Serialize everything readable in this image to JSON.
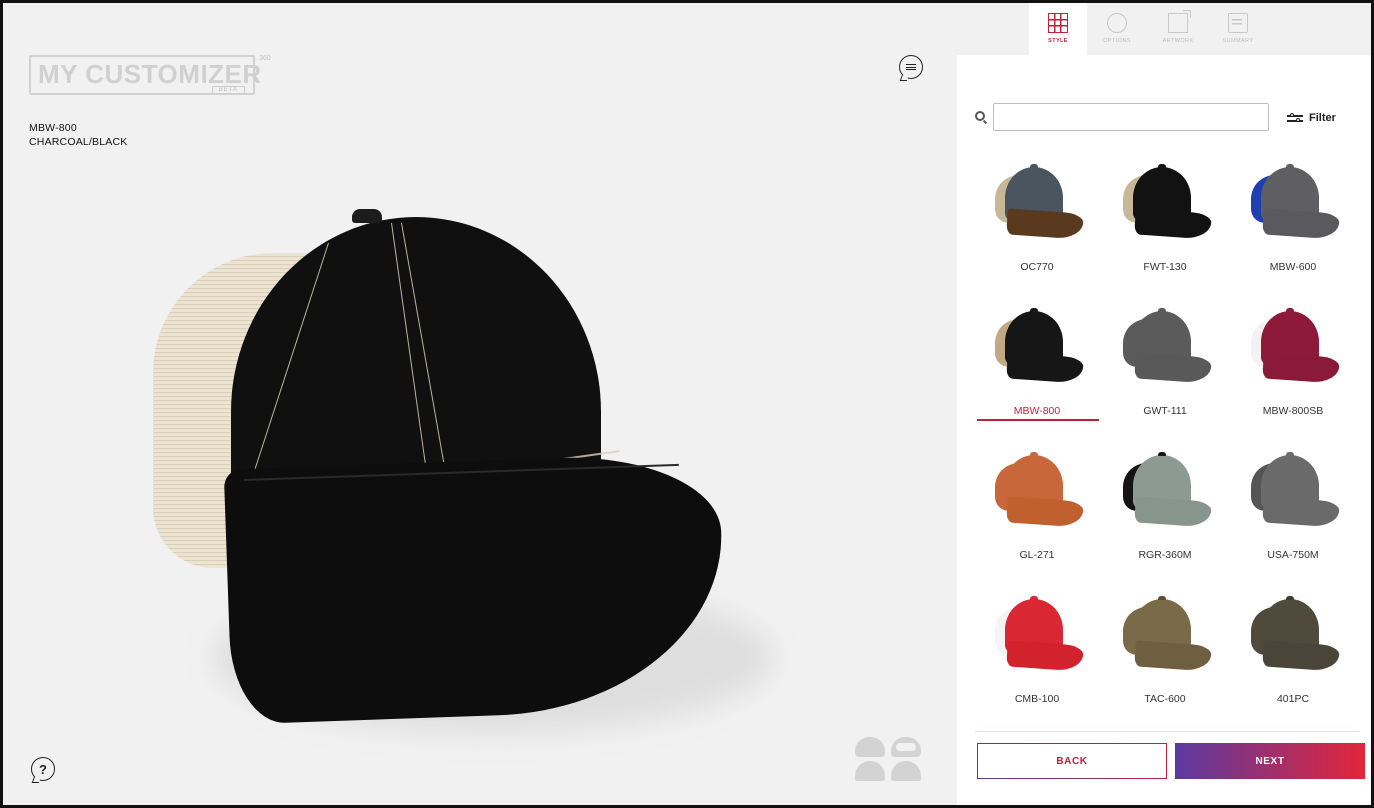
{
  "brand": {
    "name": "MY CUSTOMIZER",
    "superscript": "360",
    "tag": "BETA"
  },
  "product": {
    "code": "MBW-800",
    "color": "CHARCOAL/BLACK"
  },
  "steps": [
    {
      "label": "STYLE",
      "icon": "grid-icon",
      "active": true
    },
    {
      "label": "OPTIONS",
      "icon": "options-wheel-icon",
      "active": false
    },
    {
      "label": "ARTWORK",
      "icon": "artwork-export-icon",
      "active": false
    },
    {
      "label": "SUMMARY",
      "icon": "summary-list-icon",
      "active": false
    }
  ],
  "search": {
    "value": "",
    "placeholder": ""
  },
  "filter": {
    "label": "Filter"
  },
  "catalog": [
    {
      "code": "OC770",
      "crown": "#4a5560",
      "brim": "#5a3a1e",
      "mesh": "#c9b898",
      "btn": "#4a5560"
    },
    {
      "code": "FWT-130",
      "crown": "#121212",
      "brim": "#121212",
      "mesh": "#c9b898",
      "btn": "#121212"
    },
    {
      "code": "MBW-600",
      "crown": "#5f5f63",
      "brim": "#5a5a5e",
      "mesh": "#1f3fb0",
      "btn": "#5f5f63"
    },
    {
      "code": "MBW-800",
      "crown": "#161616",
      "brim": "#161616",
      "mesh": "#c0aa85",
      "btn": "#161616"
    },
    {
      "code": "GWT-111",
      "crown": "#5b5b5b",
      "brim": "#595959",
      "mesh": "#5b5b5b",
      "btn": "#5b5b5b"
    },
    {
      "code": "MBW-800SB",
      "crown": "#8e1a3a",
      "brim": "#8a1a38",
      "mesh": "#f2f2f2",
      "btn": "#8e1a3a"
    },
    {
      "code": "GL-271",
      "crown": "#c8683a",
      "brim": "#c0602f",
      "mesh": "#c8683a",
      "btn": "#c8683a"
    },
    {
      "code": "RGR-360M",
      "crown": "#8c9a92",
      "brim": "#87958d",
      "mesh": "#141414",
      "btn": "#141414"
    },
    {
      "code": "USA-750M",
      "crown": "#6a6a6a",
      "brim": "#6a6a6a",
      "mesh": "#555555",
      "btn": "#6a6a6a"
    },
    {
      "code": "CMB-100",
      "crown": "#d92733",
      "brim": "#d2222e",
      "mesh": "#f4f4f4",
      "btn": "#d92733"
    },
    {
      "code": "TAC-600",
      "crown": "#7a6a48",
      "brim": "#6f5f40",
      "mesh": "#7a6a48",
      "btn": "#5c4e34"
    },
    {
      "code": "401PC",
      "crown": "#4f4a3c",
      "brim": "#4a4538",
      "mesh": "#4f4a3c",
      "btn": "#3f3b30"
    }
  ],
  "selected_code": "MBW-800",
  "actions": {
    "back": "BACK",
    "next": "NEXT"
  },
  "colors": {
    "accent": "#c0223b",
    "next_gradient_start": "#5b3aa0",
    "next_gradient_end": "#e2253a"
  }
}
